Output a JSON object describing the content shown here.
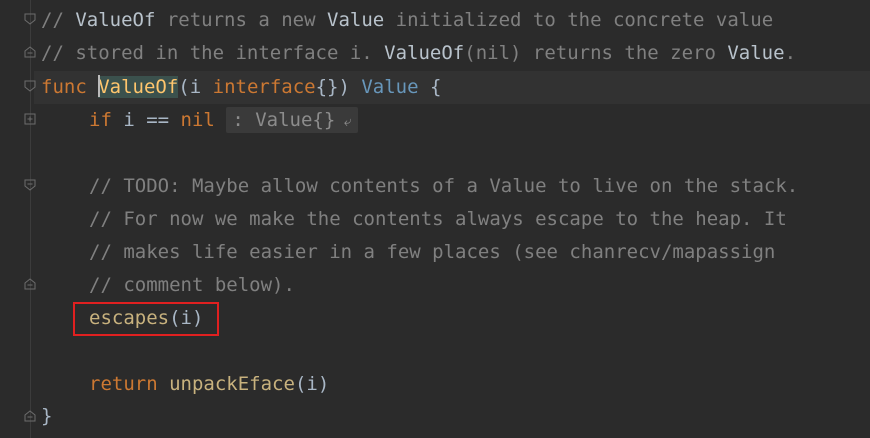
{
  "code": {
    "line1": {
      "comment_a": "// ",
      "bold_a": "ValueOf",
      "comment_b": " returns a new ",
      "bold_b": "Value",
      "comment_c": " initialized to the concrete value"
    },
    "line2": {
      "comment_a": "// stored in the interface i. ",
      "bold_a": "ValueOf",
      "comment_b": "(nil) returns the zero ",
      "bold_b": "Value",
      "comment_c": "."
    },
    "line3": {
      "kw_func": "func",
      "fn_name": "ValueOf",
      "open": "(i ",
      "kw_interface": "interface",
      "params_end": "{}) ",
      "ret_type": "Value",
      "brace": " {"
    },
    "line4": {
      "kw_if": "if",
      "cond": " i == ",
      "kw_nil": "nil",
      "folded": ": Value{}",
      "arrow": " ⤶"
    },
    "line6": "// TODO: Maybe allow contents of a Value to live on the stack.",
    "line7": "// For now we make the contents always escape to the heap. It",
    "line8": "// makes life easier in a few places (see chanrecv/mapassign",
    "line9": "// comment below).",
    "line10": {
      "call": "escapes",
      "args": "(i)"
    },
    "line12": {
      "kw_return": "return",
      "call": "unpackEface",
      "args": "(i)"
    },
    "line13": "}"
  },
  "colors": {
    "background": "#2b2b2b",
    "keyword": "#cc7832",
    "function": "#ffc66d",
    "comment": "#808080",
    "highlight_box": "#e02020"
  }
}
